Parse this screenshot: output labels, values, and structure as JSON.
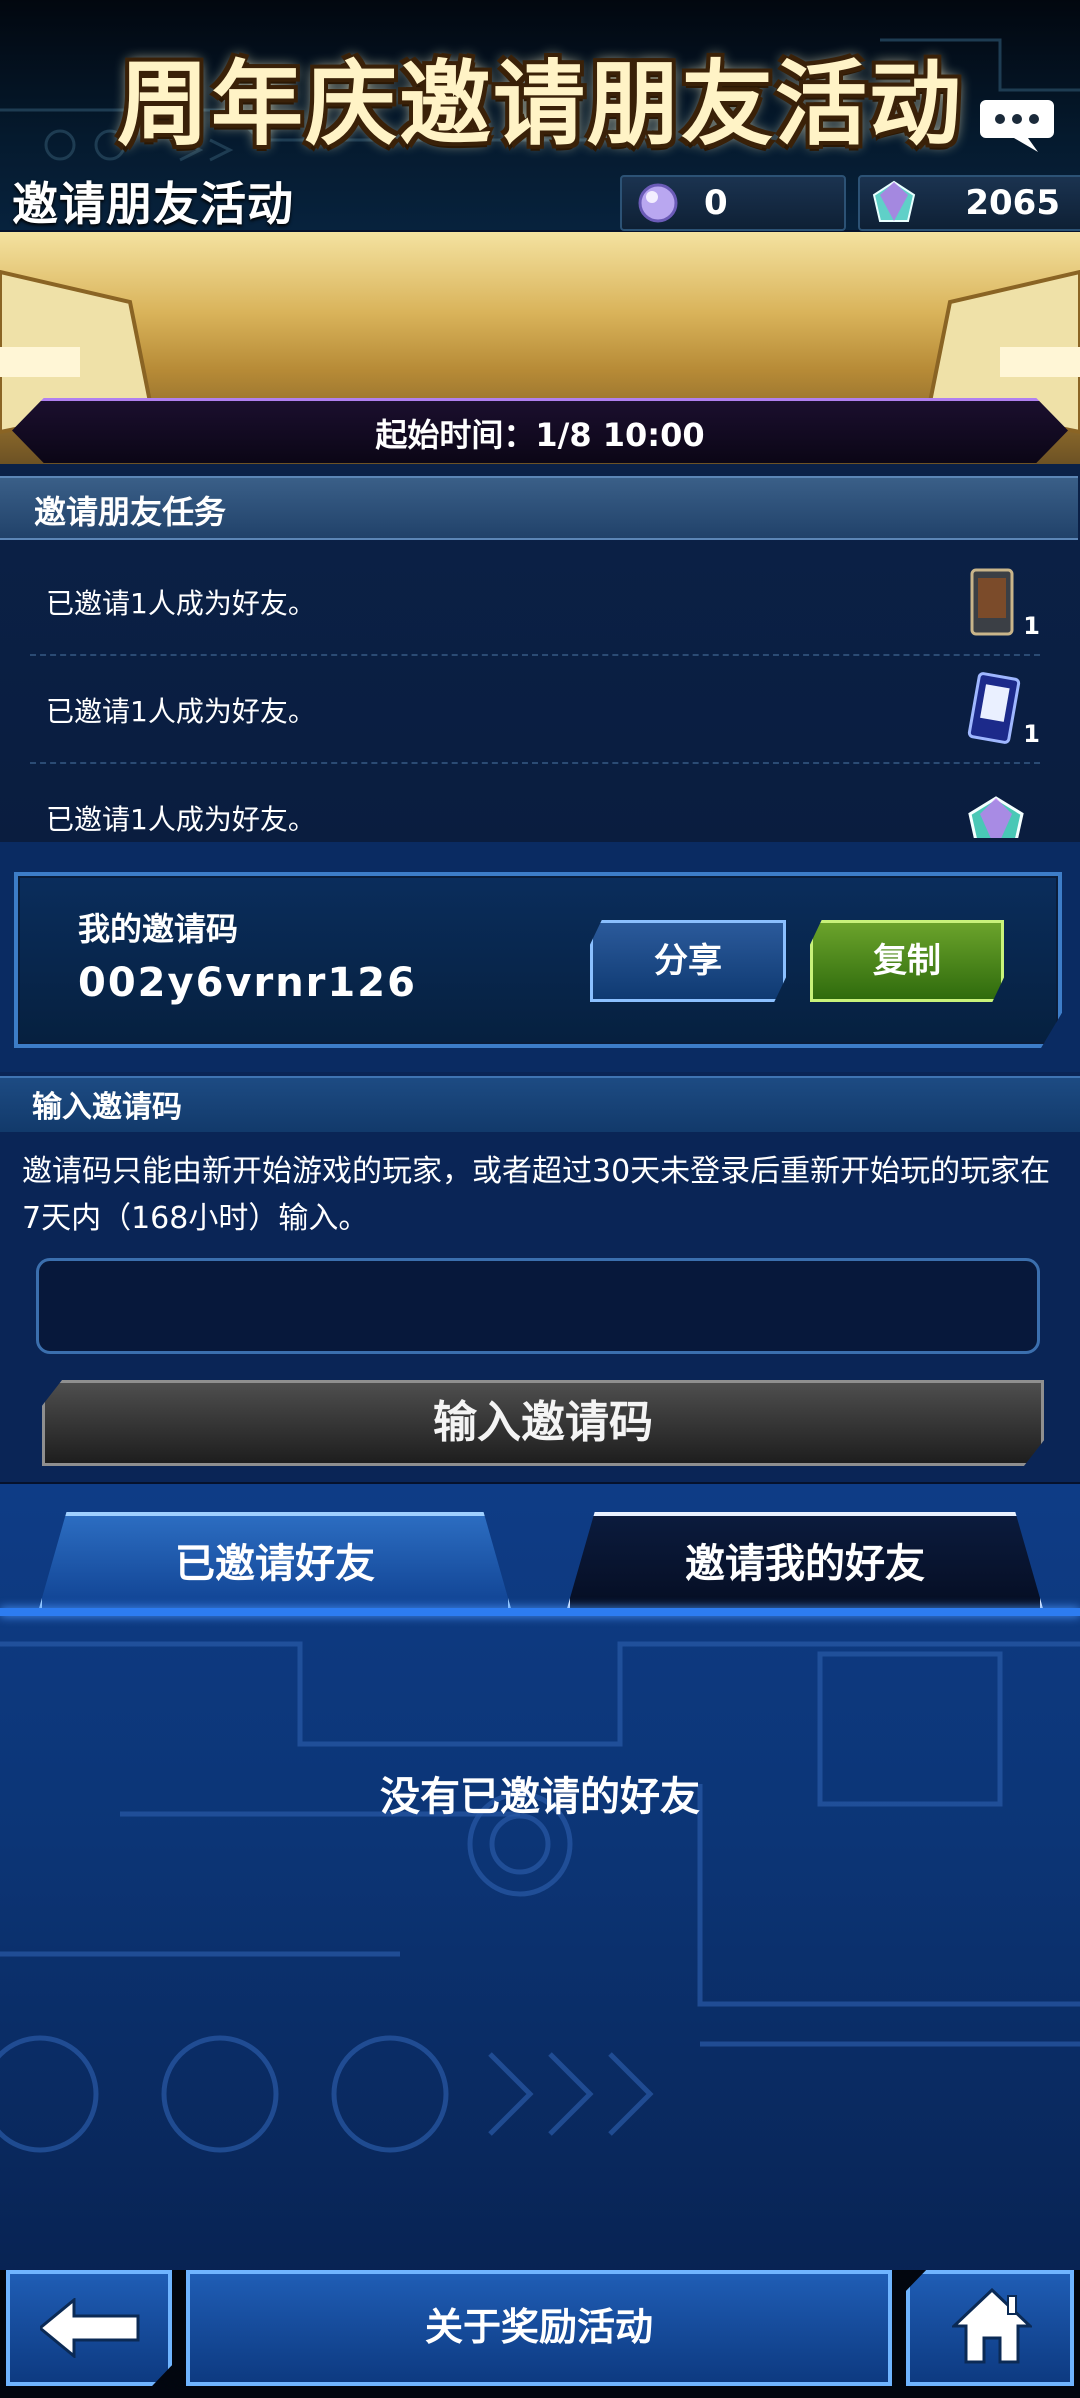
{
  "header": {
    "title": "邀请朋友活动",
    "currency_orb": "0",
    "currency_gems": "2065",
    "chat_icon": "speech-bubble-icon"
  },
  "banner": {
    "title": "周年庆邀请朋友活动",
    "start_time": "起始时间：1/8 10:00"
  },
  "tasks": {
    "header": "邀请朋友任务",
    "rows": [
      {
        "text": "已邀请1人成为好友。",
        "reward_icon": "card-sleeve-icon",
        "count": "1"
      },
      {
        "text": "已邀请1人成为好友。",
        "reward_icon": "card-protector-icon",
        "count": "1"
      },
      {
        "text": "已邀请1人成为好友。",
        "reward_icon": "gem-icon",
        "count": ""
      }
    ]
  },
  "invite_code": {
    "label": "我的邀请码",
    "value": "002y6vrnr126",
    "share_label": "分享",
    "copy_label": "复制"
  },
  "input_section": {
    "header": "输入邀请码",
    "description": "邀请码只能由新开始游戏的玩家，或者超过30天未登录后重新开始玩的玩家在7天内（168小时）输入。",
    "input_value": "",
    "submit_label": "输入邀请码"
  },
  "tabs": [
    {
      "label": "已邀请好友"
    },
    {
      "label": "邀请我的好友"
    }
  ],
  "empty_message": "没有已邀请的好友",
  "bottom": {
    "about_label": "关于奖励活动",
    "back_icon": "arrow-left-icon",
    "home_icon": "home-icon"
  },
  "colors": {
    "accent_blue": "#2d7cf0",
    "copy_green": "#6ba32b",
    "banner_gold": "#d9b35a"
  }
}
